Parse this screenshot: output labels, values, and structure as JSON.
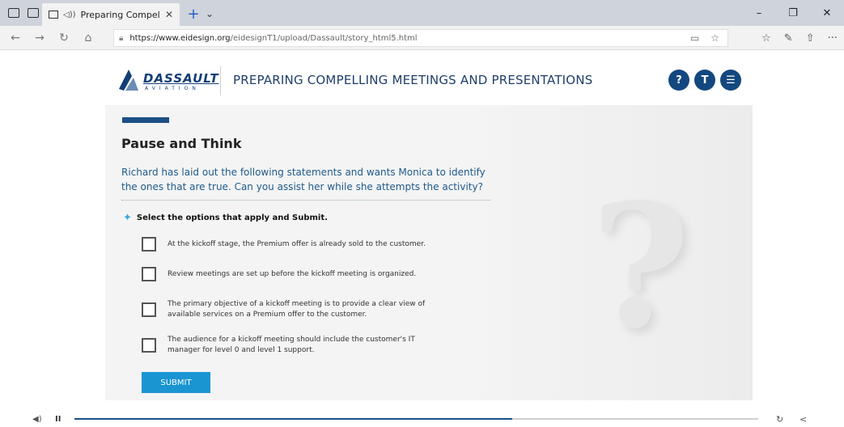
{
  "browser": {
    "tab_title": "Preparing Compelli",
    "url_domain": "https://www.eidesign.org",
    "url_path": "/eidesignT1/upload/Dassault/story_html5.html"
  },
  "course": {
    "logo_text": "DASSAULT",
    "logo_sub": "AVIATION",
    "title": "PREPARING COMPELLING MEETINGS AND PRESENTATIONS",
    "help_label": "?",
    "t_label": "T",
    "menu_label": "☰"
  },
  "content": {
    "heading": "Pause and Think",
    "intro": "Richard has laid out the following statements and wants Monica to identify the ones that are true. Can you assist her while she attempts the activity?",
    "instruction": "Select the options that apply and Submit.",
    "options": [
      "At the kickoff stage, the Premium offer is already sold to the customer.",
      "Review meetings are set up before the kickoff meeting is organized.",
      "The primary objective of a kickoff meeting is to provide a clear view of available services on a Premium offer to the customer.",
      "The audience for a kickoff meeting should include the customer's IT manager for level 0 and level 1 support."
    ],
    "submit_label": "SUBMIT",
    "decor_glyph": "?"
  },
  "player": {
    "progress": 0.64
  },
  "colors": {
    "brand": "#13477f",
    "submit": "#1a95d2",
    "intro_text": "#1f5a8c"
  }
}
